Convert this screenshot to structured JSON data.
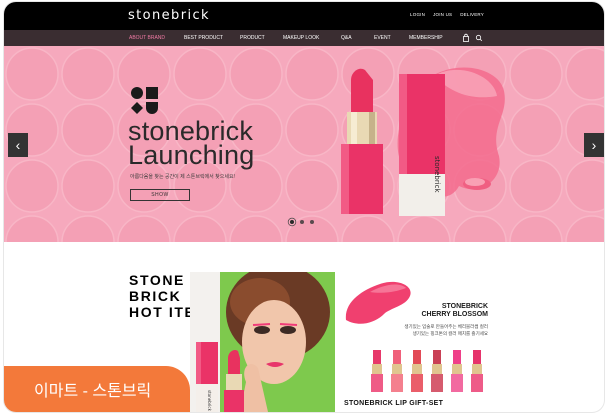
{
  "header": {
    "logo": "stonebrick",
    "util_links": [
      "LOGIN",
      "JOIN US",
      "DELIVERY"
    ]
  },
  "nav": {
    "items": [
      "ABOUT BRAND",
      "BEST PRODUCT",
      "PRODUCT",
      "MAKEUP LOOK",
      "Q&A",
      "EVENT",
      "MEMBERSHIP"
    ],
    "active_color": "#f07aa4",
    "icons": [
      "bag-icon",
      "search-icon"
    ]
  },
  "hero": {
    "title_line1": "stonebrick",
    "title_line2": "Launching",
    "subtitle": "아름다움을 찾는 공간이 제 스톤브릭에서 찾으세요!",
    "button": "SHOW",
    "lipstick_brand": "stonebrick",
    "background": "#f6a9bd",
    "slides": 3,
    "active_slide": 1
  },
  "hot_item": {
    "title_lines": [
      "STONE",
      "BRICK",
      "HOT ITEM"
    ],
    "product_name_lines": [
      "STONEBRICK",
      "CHERRY BLOSSOM"
    ],
    "product_desc_lines": [
      "생기있는 입술로 만들어주는 체리블라썸 컬러",
      "생기있는 핑크톤의 컬러 매치를 즐기세요"
    ],
    "gift_set": "STONEBRICK LIP GIFT-SET",
    "photo_brand": "stonebrick"
  },
  "caption": "이마트 - 스톤브릭",
  "colors": {
    "accent": "#f3793a",
    "lipstick_pink": "#ec2f6e",
    "nav_bg": "#3a2d31"
  }
}
